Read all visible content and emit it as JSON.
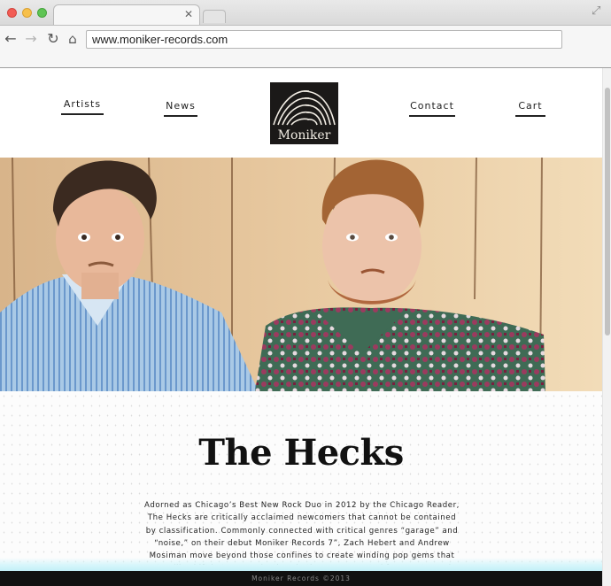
{
  "browser": {
    "tab_title": "",
    "url": "www.moniker-records.com"
  },
  "site": {
    "nav": {
      "artists": "Artists",
      "news": "News",
      "contact": "Contact",
      "cart": "Cart"
    },
    "logo_text": "Moniker",
    "hero_image": "photo of two young men in patterned shirts against wood panel wall",
    "artist_title": "The Hecks",
    "artist_bio": "Adorned as Chicago’s Best New Rock Duo in 2012 by the Chicago Reader, The Hecks are critically acclaimed newcomers that cannot be contained by classification. Commonly connected with critical genres “garage” and “noise,” on their debut Moniker Records 7”, Zach Hebert and Andrew Mosiman move beyond those confines to create winding pop gems that steadily shift between pulsating rhythms, unexpected fragments, and unrestrained feedback.",
    "footer": "Moniker Records ©2013"
  },
  "colors": {
    "footer_bg": "#111111",
    "glow": "#c2eff7",
    "logo_bg": "#1b1918"
  }
}
